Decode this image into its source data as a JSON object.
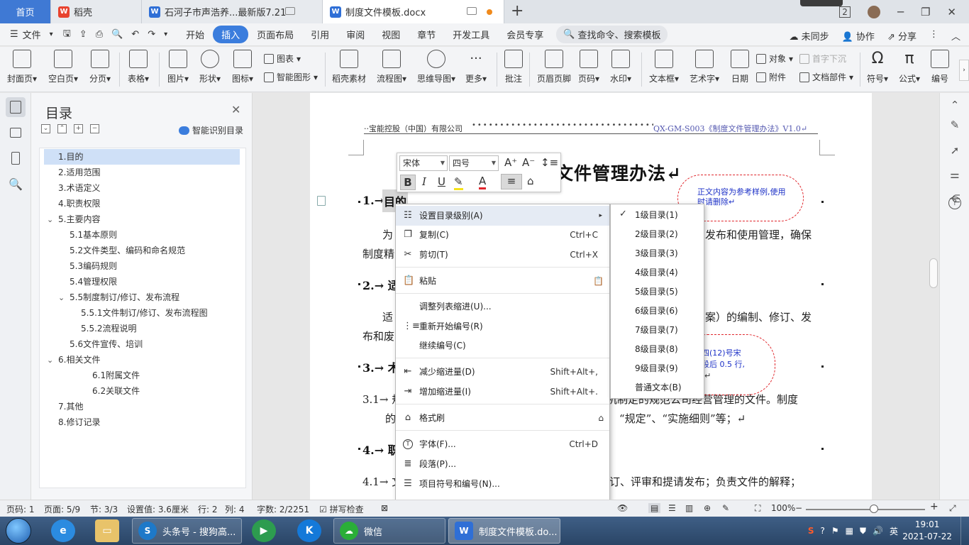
{
  "tabs": {
    "home": "首页",
    "t1": "稻壳",
    "t2": "石河子市声浩养...最新版7.21",
    "t3": "制度文件模板.docx",
    "badge": "2"
  },
  "menu": {
    "file": "文件",
    "items": [
      "开始",
      "插入",
      "页面布局",
      "引用",
      "审阅",
      "视图",
      "章节",
      "开发工具",
      "会员专享"
    ],
    "active": "插入",
    "search": "查找命令、搜索模板",
    "sync": "未同步",
    "collab": "协作",
    "share": "分享"
  },
  "ribbon": {
    "cover": "封面页",
    "blank": "空白页",
    "pagebreak": "分页",
    "table": "表格",
    "picture": "图片",
    "shape": "形状",
    "icon": "图标",
    "chart": "图表",
    "smartart": "智能图形",
    "docer": "稻壳素材",
    "flow": "流程图",
    "mind": "思维导图",
    "more": "更多",
    "comment": "批注",
    "headerfooter": "页眉页脚",
    "pagenum": "页码",
    "watermark": "水印",
    "textbox": "文本框",
    "wordart": "艺术字",
    "date": "日期",
    "object": "对象",
    "attachment": "附件",
    "dropcap": "首字下沉",
    "docpart": "文档部件",
    "symbol": "符号",
    "formula": "公式",
    "number": "编号"
  },
  "toc": {
    "title": "目录",
    "smart": "智能识别目录",
    "items": [
      "1.目的",
      "2.适用范围",
      "3.术语定义",
      "4.职责权限",
      "5.主要内容",
      "5.1基本原则",
      "5.2文件类型、编码和命名规范",
      "5.3编码规则",
      "5.4管理权限",
      "5.5制度制订/修订、发布流程",
      "5.5.1文件制订/修订、发布流程图",
      "5.5.2流程说明",
      "5.6文件宣传、培训",
      "6.相关文件",
      "6.1附属文件",
      "6.2关联文件",
      "7.其他",
      "8.修订记录"
    ]
  },
  "doc": {
    "header_left": "··宝能控股（中国）有限公司",
    "header_right": "QX-GM-S003《制度文件管理办法》V1.0↵",
    "title": "文件管理办法↵",
    "h1": "1.→",
    "h1b": "目的",
    "p1a": "为",
    "p1b": "发布和使用管理，确保",
    "p1c": "制度精",
    "h2": "2.→ 适",
    "p2a": "适",
    "p2b": "案）的编制、修订、发",
    "p2c": "布和废",
    "h3": "3.→ 术",
    "p3a": "3.1→ 规",
    "p3b": "机制定的规范公司经营管理的文件。制度",
    "p3c": "的",
    "p3d": "“规定”、“实施细则”等；↵",
    "h4": "4.→ 职",
    "p4a": "4.1→ 文",
    "p4b": "订、评审和提请发布；负责文件的解释；",
    "cloud1": "正文内容为参考样例,使用时请删除↵",
    "cloud2a": "四(12)号宋",
    "cloud2b": "段后 0.5 行,",
    "cloud2c": "↵"
  },
  "minitb": {
    "font": "宋体",
    "size": "四号"
  },
  "ctx": {
    "items": [
      {
        "label": "设置目录级别(A)",
        "sc": "",
        "icon": "toc-level-icon"
      },
      {
        "label": "复制(C)",
        "sc": "Ctrl+C",
        "icon": "copy-icon"
      },
      {
        "label": "剪切(T)",
        "sc": "Ctrl+X",
        "icon": "cut-icon"
      },
      {
        "label": "粘贴",
        "sc": "",
        "icon": "paste-icon"
      },
      {
        "label": "调整列表缩进(U)...",
        "sc": "",
        "icon": ""
      },
      {
        "label": "重新开始编号(R)",
        "sc": "",
        "icon": "restart-numbering-icon"
      },
      {
        "label": "继续编号(C)",
        "sc": "",
        "icon": ""
      },
      {
        "label": "减少缩进量(D)",
        "sc": "Shift+Alt+,",
        "icon": "decrease-indent-icon"
      },
      {
        "label": "增加缩进量(I)",
        "sc": "Shift+Alt+.",
        "icon": "increase-indent-icon"
      },
      {
        "label": "格式刷",
        "sc": "",
        "icon": "format-painter-icon"
      },
      {
        "label": "字体(F)...",
        "sc": "Ctrl+D",
        "icon": "font-icon"
      },
      {
        "label": "段落(P)...",
        "sc": "",
        "icon": "paragraph-icon"
      },
      {
        "label": "项目符号和编号(N)...",
        "sc": "",
        "icon": "bullets-icon"
      }
    ]
  },
  "sub": {
    "items": [
      "1级目录(1)",
      "2级目录(2)",
      "3级目录(3)",
      "4级目录(4)",
      "5级目录(5)",
      "6级目录(6)",
      "7级目录(7)",
      "8级目录(8)",
      "9级目录(9)",
      "普通文本(B)"
    ]
  },
  "status": {
    "page_code": "页码: 1",
    "page": "页面: 5/9",
    "section": "节: 3/3",
    "setting": "设置值: 3.6厘米",
    "row": "行: 2",
    "col": "列: 4",
    "words": "字数: 2/2251",
    "spell": "拼写检查",
    "zoom": "100%"
  },
  "taskbar": {
    "t1": "头条号 - 搜狗高...",
    "t2": "微信",
    "t3": "制度文件模板.do...",
    "time": "19:01",
    "date": "2021-07-22"
  },
  "colors": {
    "accent": "#3b7ddd",
    "cloud": "#e0262c"
  }
}
